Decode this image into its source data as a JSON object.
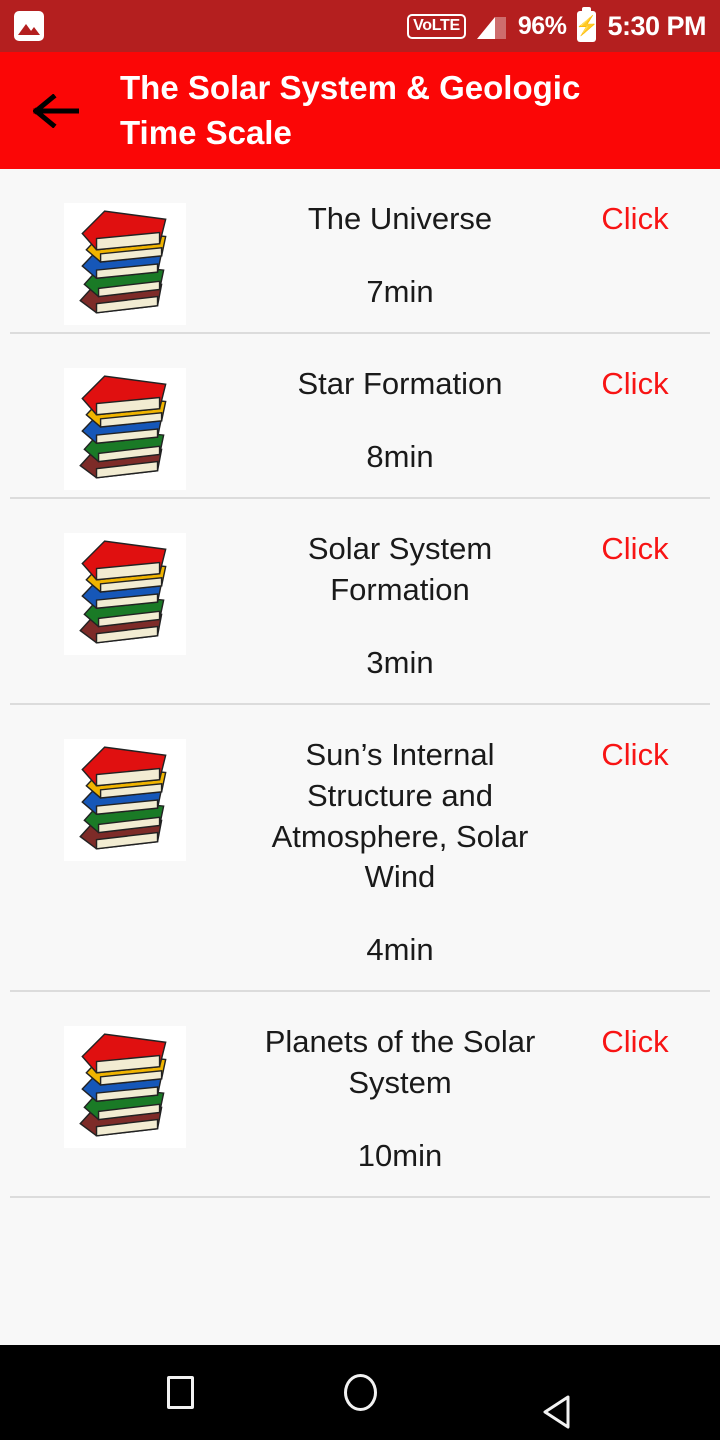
{
  "status_bar": {
    "notification_icon": "photo-icon",
    "volte_label": "VoLTE",
    "signal_icon": "signal-bars-icon",
    "battery_percent": "96%",
    "battery_icon": "battery-charging-icon",
    "battery_bolt": "⚡",
    "time": "5:30 PM",
    "background_color": "#b41f1f"
  },
  "app_bar": {
    "back_icon": "arrow-left-icon",
    "title": "The Solar System & Geologic Time Scale",
    "background_color": "#fb0606",
    "title_color": "#ffffff"
  },
  "list": {
    "action_label": "Click",
    "action_color": "#f81414",
    "thumbnail_icon": "stack-of-books-icon",
    "items": [
      {
        "title": "The Universe",
        "duration": "7min",
        "action": "Click"
      },
      {
        "title": "Star Formation",
        "duration": "8min",
        "action": "Click"
      },
      {
        "title": "Solar System Formation",
        "duration": "3min",
        "action": "Click"
      },
      {
        "title": "Sun’s Internal Structure and Atmosphere, Solar Wind",
        "duration": "4min",
        "action": "Click"
      },
      {
        "title": "Planets of the Solar System",
        "duration": "10min",
        "action": "Click"
      }
    ]
  },
  "nav_bar": {
    "recents_icon": "square-recents-icon",
    "home_icon": "circle-home-icon",
    "back_icon": "triangle-back-icon",
    "background_color": "#000000"
  }
}
